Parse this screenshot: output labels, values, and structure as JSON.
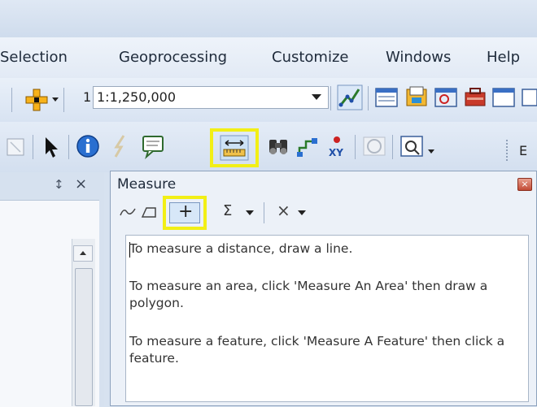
{
  "menu": [
    "Selection",
    "Geoprocessing",
    "Customize",
    "Windows",
    "Help"
  ],
  "toolbar": {
    "scale_value": "1:1,250,000"
  },
  "toolbar2": {
    "editor_label": "E"
  },
  "panel": {
    "pin_label": "↕",
    "close_label": "×"
  },
  "dialog": {
    "title": "Measure",
    "close_label": "×",
    "tools": {
      "add_label": "+",
      "sum_label": "Σ",
      "clear_label": "×"
    },
    "messages": [
      "To measure a distance, draw a line.",
      "To measure an area, click 'Measure An Area' then draw a polygon.",
      "To measure a feature, click 'Measure A Feature' then click a feature."
    ]
  },
  "colors": {
    "highlight": "#f2ef16",
    "accent": "#1f5fb8"
  }
}
